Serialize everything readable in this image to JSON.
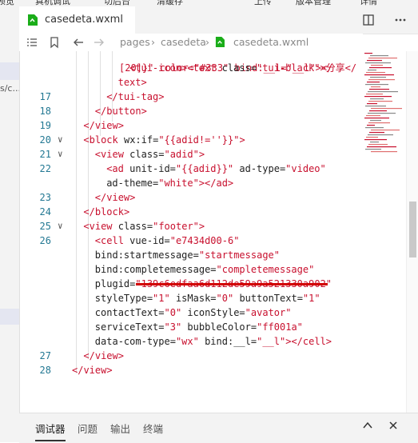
{
  "menu_items": [
    "预览",
    "真机调试",
    "切后台",
    "清缓存",
    "上传",
    "版本管理",
    "详情"
  ],
  "left_panel": {
    "path_fragment": "s/c..."
  },
  "tab": {
    "title": "casedeta.wxml"
  },
  "breadcrumb": {
    "seg1": "pages",
    "seg2": "casedeta",
    "seg3": "casedeta.wxml"
  },
  "icons": {
    "split_editor": "split-editor-icon",
    "more": "more-icon",
    "file": "wxml-file-icon"
  },
  "editor": {
    "top_partial": "[20]}\" color=\"#333\" bind:__l=\"__l\"></",
    "lines": [
      {
        "num": "",
        "fold": "",
        "tokens": [
          {
            "t": "<tui-icon>",
            "c": "tag"
          },
          {
            "t": "<text ",
            "c": "tag"
          },
          {
            "t": "class=",
            "c": "attr"
          },
          {
            "t": "\"tui-black\"",
            "c": "val"
          },
          {
            "t": ">分享</",
            "c": "tag"
          }
        ]
      },
      {
        "num": "",
        "fold": "",
        "tokens": [
          {
            "t": "text>",
            "c": "tag"
          }
        ]
      },
      {
        "num": "17",
        "fold": "",
        "tokens": [
          {
            "t": "</tui-tag>",
            "c": "tag"
          }
        ]
      },
      {
        "num": "18",
        "fold": "",
        "tokens": [
          {
            "t": "</button>",
            "c": "tag"
          }
        ]
      },
      {
        "num": "19",
        "fold": "",
        "tokens": [
          {
            "t": "</view>",
            "c": "tag"
          }
        ]
      },
      {
        "num": "20",
        "fold": "v",
        "tokens": [
          {
            "t": "<block ",
            "c": "tag"
          },
          {
            "t": "wx:if=",
            "c": "attr"
          },
          {
            "t": "\"{{adid!=''}}\"",
            "c": "val"
          },
          {
            "t": ">",
            "c": "tag"
          }
        ]
      },
      {
        "num": "21",
        "fold": "v",
        "tokens": [
          {
            "t": "<view ",
            "c": "tag"
          },
          {
            "t": "class=",
            "c": "attr"
          },
          {
            "t": "\"adid\"",
            "c": "val"
          },
          {
            "t": ">",
            "c": "tag"
          }
        ]
      },
      {
        "num": "22",
        "fold": "",
        "tokens": [
          {
            "t": "<ad ",
            "c": "tag"
          },
          {
            "t": "unit-id=",
            "c": "attr"
          },
          {
            "t": "\"{{adid}}\"",
            "c": "val"
          },
          {
            "t": " ad-type=",
            "c": "attr"
          },
          {
            "t": "\"video\"",
            "c": "val"
          }
        ]
      },
      {
        "num": "",
        "fold": "",
        "tokens": [
          {
            "t": "ad-theme=",
            "c": "attr"
          },
          {
            "t": "\"white\"",
            "c": "val"
          },
          {
            "t": "></ad>",
            "c": "tag"
          }
        ]
      },
      {
        "num": "23",
        "fold": "",
        "tokens": [
          {
            "t": "</view>",
            "c": "tag"
          }
        ]
      },
      {
        "num": "24",
        "fold": "",
        "tokens": [
          {
            "t": "</block>",
            "c": "tag"
          }
        ]
      },
      {
        "num": "25",
        "fold": "v",
        "tokens": [
          {
            "t": "<view ",
            "c": "tag"
          },
          {
            "t": "class=",
            "c": "attr"
          },
          {
            "t": "\"footer\"",
            "c": "val"
          },
          {
            "t": ">",
            "c": "tag"
          }
        ]
      },
      {
        "num": "26",
        "fold": "",
        "tokens": [
          {
            "t": "<cell ",
            "c": "tag"
          },
          {
            "t": "vue-id=",
            "c": "attr"
          },
          {
            "t": "\"e7434d00-6\"",
            "c": "val"
          }
        ]
      },
      {
        "num": "",
        "fold": "",
        "tokens": [
          {
            "t": "bind:startmessage=",
            "c": "attr"
          },
          {
            "t": "\"startmessage\"",
            "c": "val"
          }
        ]
      },
      {
        "num": "",
        "fold": "",
        "tokens": [
          {
            "t": "bind:completemessage=",
            "c": "attr"
          },
          {
            "t": "\"completemessage\"",
            "c": "val"
          }
        ]
      },
      {
        "num": "",
        "fold": "",
        "tokens": [
          {
            "t": "plugid=",
            "c": "attr"
          },
          {
            "t": "\"139c6edfaa6d112de59a9a521330a902\"",
            "c": "val"
          }
        ]
      },
      {
        "num": "",
        "fold": "",
        "tokens": [
          {
            "t": "styleType=",
            "c": "attr"
          },
          {
            "t": "\"1\"",
            "c": "val"
          },
          {
            "t": " isMask=",
            "c": "attr"
          },
          {
            "t": "\"0\"",
            "c": "val"
          },
          {
            "t": " buttonText=",
            "c": "attr"
          },
          {
            "t": "\"1\"",
            "c": "val"
          }
        ]
      },
      {
        "num": "",
        "fold": "",
        "tokens": [
          {
            "t": "contactText=",
            "c": "attr"
          },
          {
            "t": "\"0\"",
            "c": "val"
          },
          {
            "t": " iconStyle=",
            "c": "attr"
          },
          {
            "t": "\"avator\"",
            "c": "val"
          }
        ]
      },
      {
        "num": "",
        "fold": "",
        "tokens": [
          {
            "t": "serviceText=",
            "c": "attr"
          },
          {
            "t": "\"3\"",
            "c": "val"
          },
          {
            "t": " bubbleColor=",
            "c": "attr"
          },
          {
            "t": "\"ff001a\"",
            "c": "val"
          }
        ]
      },
      {
        "num": "",
        "fold": "",
        "tokens": [
          {
            "t": "data-com-type=",
            "c": "attr"
          },
          {
            "t": "\"wx\"",
            "c": "val"
          },
          {
            "t": " bind:__l=",
            "c": "attr"
          },
          {
            "t": "\"__l\"",
            "c": "val"
          },
          {
            "t": "></cell>",
            "c": "tag"
          }
        ]
      },
      {
        "num": "27",
        "fold": "",
        "tokens": [
          {
            "t": "</view>",
            "c": "tag"
          }
        ]
      },
      {
        "num": "28",
        "fold": "",
        "tokens": [
          {
            "t": "</view>",
            "c": "tag"
          }
        ]
      }
    ]
  },
  "bottom_panel": {
    "tabs": [
      "调试器",
      "问题",
      "输出",
      "终端"
    ],
    "active": 0,
    "icons": [
      "chevron-up-icon",
      "close-icon"
    ]
  },
  "colors": {
    "tag": "#c8102e",
    "value": "#c8102e",
    "attr": "#222222",
    "line_number": "#237893",
    "highlight_underline": "#d20000"
  }
}
